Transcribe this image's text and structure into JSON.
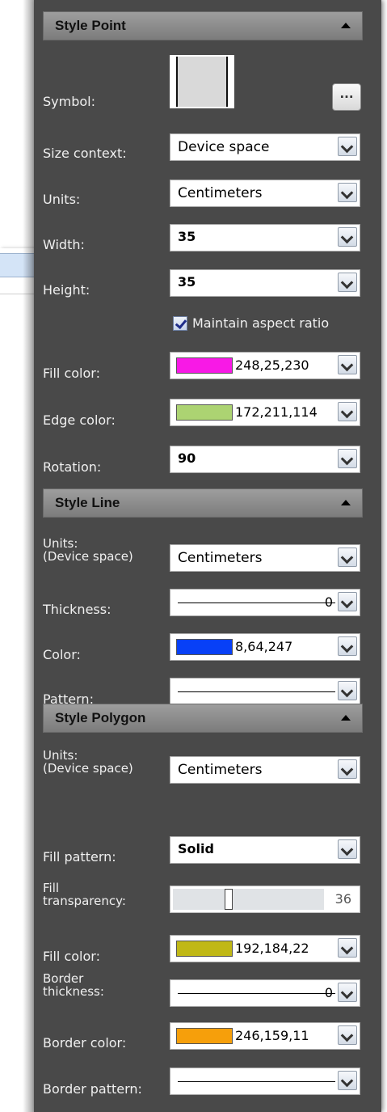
{
  "sections": {
    "point": "Style Point",
    "line": "Style Line",
    "polygon": "Style Polygon"
  },
  "point": {
    "symbol_label": "Symbol:",
    "ellipsis": "...",
    "size_context_label": "Size context:",
    "size_context_value": "Device space",
    "units_label": "Units:",
    "units_value": "Centimeters",
    "width_label": "Width:",
    "width_value": "35",
    "height_label": "Height:",
    "height_value": "35",
    "maintain_aspect": "Maintain aspect ratio",
    "maintain_aspect_checked": true,
    "fill_color_label": "Fill color:",
    "fill_color_value": "248,25,230",
    "fill_color_hex": "#f819e6",
    "edge_color_label": "Edge color:",
    "edge_color_value": "172,211,114",
    "edge_color_hex": "#acd372",
    "rotation_label": "Rotation:",
    "rotation_value": "90"
  },
  "line": {
    "units_label": "Units:\n(Device space)",
    "units_value": "Centimeters",
    "thickness_label": "Thickness:",
    "thickness_value": "0",
    "color_label": "Color:",
    "color_value": "8,64,247",
    "color_hex": "#0840f7",
    "pattern_label": "Pattern:"
  },
  "polygon": {
    "units_label": "Units:\n(Device space)",
    "units_value": "Centimeters",
    "fill_pattern_label": "Fill pattern:",
    "fill_pattern_value": "Solid",
    "fill_transparency_label": "Fill\ntransparency:",
    "fill_transparency_value": "36",
    "fill_color_label": "Fill color:",
    "fill_color_value": "192,184,22",
    "fill_color_hex": "#c0b816",
    "border_thickness_label": "Border\nthickness:",
    "border_thickness_value": "0",
    "border_color_label": "Border color:",
    "border_color_value": "246,159,11",
    "border_color_hex": "#f69f0b",
    "border_pattern_label": "Border pattern:"
  }
}
